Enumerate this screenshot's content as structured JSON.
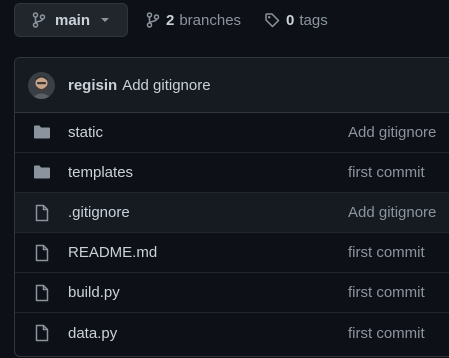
{
  "toolbar": {
    "branch_name": "main",
    "branches_count": "2",
    "branches_label": "branches",
    "tags_count": "0",
    "tags_label": "tags"
  },
  "latest_commit": {
    "author": "regisin",
    "message": "Add gitignore"
  },
  "files": [
    {
      "type": "folder",
      "icon": "folder-icon",
      "name": "static",
      "commit": "Add gitignore"
    },
    {
      "type": "folder",
      "icon": "folder-icon",
      "name": "templates",
      "commit": "first commit"
    },
    {
      "type": "file",
      "icon": "file-icon",
      "name": ".gitignore",
      "commit": "Add gitignore"
    },
    {
      "type": "file",
      "icon": "file-icon",
      "name": "README.md",
      "commit": "first commit"
    },
    {
      "type": "file",
      "icon": "file-icon",
      "name": "build.py",
      "commit": "first commit"
    },
    {
      "type": "file",
      "icon": "file-icon",
      "name": "data.py",
      "commit": "first commit"
    }
  ],
  "colors": {
    "background": "#0d1117",
    "header_bg": "#161b22",
    "border": "#30363d",
    "text": "#c9d1d9",
    "muted": "#8b949e",
    "icon": "#8b949e"
  }
}
